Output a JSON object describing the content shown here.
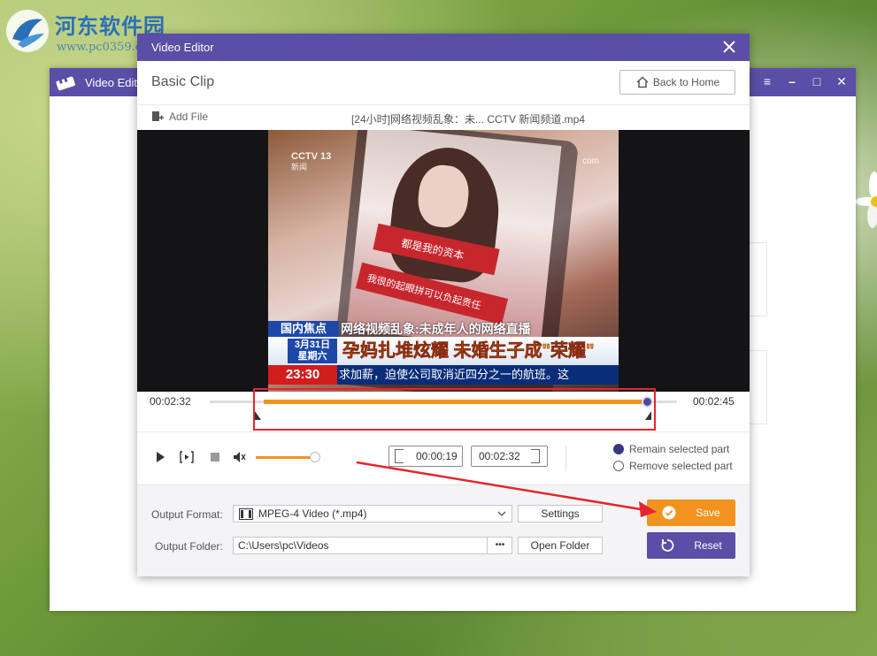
{
  "watermark": {
    "title": "河东软件园",
    "url": "www.pc0359.cn"
  },
  "background_app": {
    "title": "Video Editor"
  },
  "dialog": {
    "title": "Video Editor",
    "section_title": "Basic Clip",
    "back_label": "Back to Home",
    "add_file_label": "Add File",
    "file_name": "[24小时]网络视频乱象：未... CCTV 新闻频道.mp4"
  },
  "video_frame": {
    "channel_logo": "CCTV 13",
    "channel_sub": "新闻",
    "corner_text": "com",
    "band1_text": "都是我的资本",
    "band2_text": "我很的起眼拼可以负起责任",
    "tag": "国内焦点",
    "headline": "网络视频乱象:未成年人的网络直播",
    "date_line1": "3月31日",
    "date_line2": "星期六",
    "big_caption": "孕妈扎堆炫耀 未婚生子成\"荣耀\"",
    "clock": "23:30",
    "scroll_text": "求加薪，迫使公司取消近四分之一的航班。这"
  },
  "trim": {
    "start_time": "00:02:32",
    "end_time": "00:02:45",
    "selected_start_fraction": 0.115,
    "selected_end_fraction": 0.935
  },
  "controls": {
    "volume_fraction": 0.9,
    "clip_start": "00:00:19",
    "clip_end": "00:02:32",
    "radio_remain": "Remain selected part",
    "radio_remove": "Remove selected part",
    "selected_mode": "remain"
  },
  "output": {
    "format_label": "Output Format:",
    "format_value": "MPEG-4 Video (*.mp4)",
    "settings_label": "Settings",
    "folder_label": "Output Folder:",
    "folder_value": "C:\\Users\\pc\\Videos",
    "dots_label": "•••",
    "open_folder_label": "Open Folder",
    "save_label": "Save",
    "reset_label": "Reset"
  },
  "colors": {
    "accent_purple": "#5a4ea6",
    "accent_orange": "#f2931f",
    "highlight_red": "#e3262e"
  }
}
